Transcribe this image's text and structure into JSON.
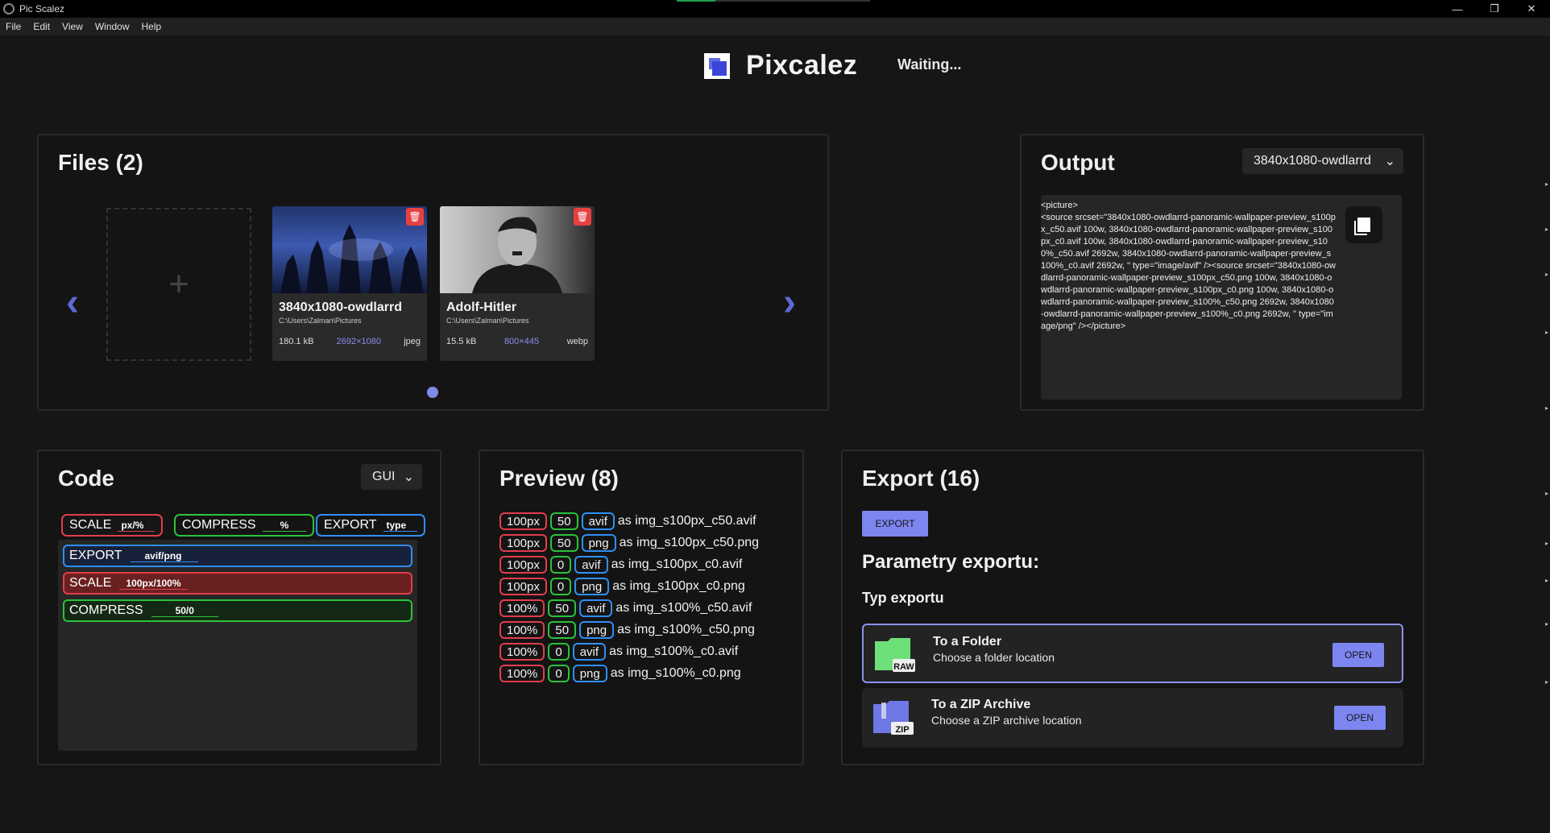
{
  "window": {
    "title": "Pic Scalez",
    "controls": [
      "—",
      "❐",
      "✕"
    ]
  },
  "menu": [
    "File",
    "Edit",
    "View",
    "Window",
    "Help"
  ],
  "header": {
    "brand": "Pixcalez",
    "status": "Waiting..."
  },
  "files": {
    "title": "Files (2)",
    "items": [
      {
        "name": "3840x1080-owdlarrd",
        "path": "C:\\Users\\Zalman\\Pictures",
        "size": "180.1 kB",
        "dims": "2692×1080",
        "type": "jpeg"
      },
      {
        "name": "Adolf-Hitler",
        "path": "C:\\Users\\Zalman\\Pictures",
        "size": "15.5 kB",
        "dims": "800×445",
        "type": "webp"
      }
    ]
  },
  "output": {
    "title": "Output",
    "selected": "3840x1080-owdlarrd",
    "code": "<picture>\n<source srcset=\"3840x1080-owdlarrd-panoramic-wallpaper-preview_s100px_c50.avif 100w, 3840x1080-owdlarrd-panoramic-wallpaper-preview_s100px_c0.avif 100w, 3840x1080-owdlarrd-panoramic-wallpaper-preview_s100%_c50.avif 2692w, 3840x1080-owdlarrd-panoramic-wallpaper-preview_s100%_c0.avif 2692w, \" type=\"image/avif\" /><source srcset=\"3840x1080-owdlarrd-panoramic-wallpaper-preview_s100px_c50.png 100w, 3840x1080-owdlarrd-panoramic-wallpaper-preview_s100px_c0.png 100w, 3840x1080-owdlarrd-panoramic-wallpaper-preview_s100%_c50.png 2692w, 3840x1080-owdlarrd-panoramic-wallpaper-preview_s100%_c0.png 2692w, \" type=\"image/png\" /></picture>"
  },
  "code": {
    "title": "Code",
    "mode": "GUI",
    "chips": [
      {
        "label": "SCALE",
        "hint": "px/%"
      },
      {
        "label": "COMPRESS",
        "hint": "%"
      },
      {
        "label": "EXPORT",
        "hint": "type"
      }
    ],
    "rows": [
      {
        "label": "EXPORT",
        "value": "avif/png"
      },
      {
        "label": "SCALE",
        "value": "100px/100%"
      },
      {
        "label": "COMPRESS",
        "value": "50/0"
      }
    ]
  },
  "preview": {
    "title": "Preview (8)",
    "items": [
      {
        "scale": "100px",
        "compress": "50",
        "type": "avif",
        "as": "as img_s100px_c50.avif"
      },
      {
        "scale": "100px",
        "compress": "50",
        "type": "png",
        "as": "as img_s100px_c50.png"
      },
      {
        "scale": "100px",
        "compress": "0",
        "type": "avif",
        "as": "as img_s100px_c0.avif"
      },
      {
        "scale": "100px",
        "compress": "0",
        "type": "png",
        "as": "as img_s100px_c0.png"
      },
      {
        "scale": "100%",
        "compress": "50",
        "type": "avif",
        "as": "as img_s100%_c50.avif"
      },
      {
        "scale": "100%",
        "compress": "50",
        "type": "png",
        "as": "as img_s100%_c50.png"
      },
      {
        "scale": "100%",
        "compress": "0",
        "type": "avif",
        "as": "as img_s100%_c0.avif"
      },
      {
        "scale": "100%",
        "compress": "0",
        "type": "png",
        "as": "as img_s100%_c0.png"
      }
    ]
  },
  "export": {
    "title": "Export (16)",
    "button": "EXPORT",
    "params_title": "Parametry exportu:",
    "type_title": "Typ exportu",
    "options": [
      {
        "title": "To a Folder",
        "desc": "Choose a folder location",
        "badge": "RAW",
        "button": "OPEN"
      },
      {
        "title": "To a ZIP Archive",
        "desc": "Choose a ZIP archive location",
        "badge": "ZIP",
        "button": "OPEN"
      }
    ]
  },
  "colors": {
    "accent": "#7d85f0",
    "red": "#e23d4c",
    "green": "#2bc23b",
    "blue": "#2f8ff5",
    "delete": "#e64040"
  },
  "icons": [
    "app-icon",
    "logo-icon",
    "chevron-left-icon",
    "chevron-right-icon",
    "plus-icon",
    "trash-icon",
    "copy-icon",
    "folder-icon",
    "zip-icon",
    "chevron-down-icon"
  ]
}
